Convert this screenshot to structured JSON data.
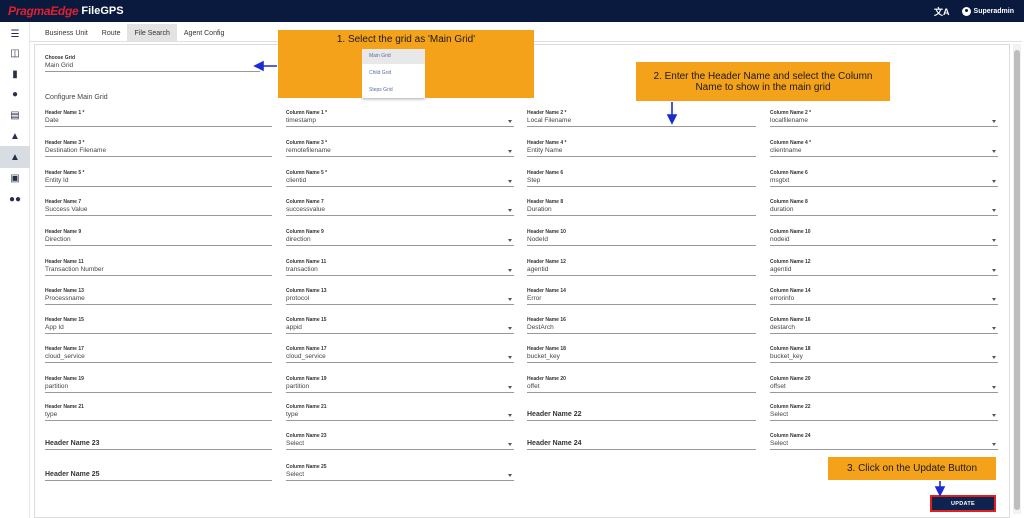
{
  "header": {
    "brand_primary": "PragmaEdge",
    "brand_secondary": "FileGPS",
    "translate_icon": "translate-icon",
    "user_name": "Superadmin",
    "bg_color": "#0a1a3f",
    "brand_color": "#e0202e"
  },
  "sidebar": {
    "items": [
      {
        "icon": "menu-icon"
      },
      {
        "icon": "files-icon"
      },
      {
        "icon": "chart-icon"
      },
      {
        "icon": "account-icon"
      },
      {
        "icon": "document-icon"
      },
      {
        "icon": "bell-icon"
      },
      {
        "icon": "alert-bell-icon"
      },
      {
        "icon": "settings-icon"
      },
      {
        "icon": "group-icon"
      }
    ]
  },
  "tabs": [
    {
      "label": "Business Unit"
    },
    {
      "label": "Route"
    },
    {
      "label": "File Search"
    },
    {
      "label": "Agent Config"
    }
  ],
  "choose_grid": {
    "label": "Choose Grid",
    "value": "Main Grid"
  },
  "grid_dropdown": {
    "options": [
      "Main Grid",
      "Child Grid",
      "Steps Grid"
    ],
    "selected": "Main Grid"
  },
  "config_title": "Configure Main Grid",
  "rows": [
    [
      {
        "label": "Header Name 1 *",
        "value": "Date"
      },
      {
        "label": "Column Name 1 *",
        "value": "timestamp"
      },
      {
        "label": "Header Name 2 *",
        "value": "Local Filename"
      },
      {
        "label": "Column Name 2 *",
        "value": "localfilename"
      }
    ],
    [
      {
        "label": "Header Name 3 *",
        "value": "Destination Filename"
      },
      {
        "label": "Column Name 3 *",
        "value": "remotefilename"
      },
      {
        "label": "Header Name 4 *",
        "value": "Entity Name"
      },
      {
        "label": "Column Name 4 *",
        "value": "clientname"
      }
    ],
    [
      {
        "label": "Header Name 5 *",
        "value": "Entity Id"
      },
      {
        "label": "Column Name 5 *",
        "value": "clientid"
      },
      {
        "label": "Header Name 6",
        "value": "Step"
      },
      {
        "label": "Column Name 6",
        "value": "msgtxt"
      }
    ],
    [
      {
        "label": "Header Name 7",
        "value": "Success Value"
      },
      {
        "label": "Column Name 7",
        "value": "successvalue"
      },
      {
        "label": "Header Name 8",
        "value": "Duration"
      },
      {
        "label": "Column Name 8",
        "value": "duration"
      }
    ],
    [
      {
        "label": "Header Name 9",
        "value": "Direction"
      },
      {
        "label": "Column Name 9",
        "value": "direction"
      },
      {
        "label": "Header Name 10",
        "value": "NodeId"
      },
      {
        "label": "Column Name 10",
        "value": "nodeid"
      }
    ],
    [
      {
        "label": "Header Name 11",
        "value": "Transaction Number"
      },
      {
        "label": "Column Name 11",
        "value": "transaction"
      },
      {
        "label": "Header Name 12",
        "value": "agentid"
      },
      {
        "label": "Column Name 12",
        "value": "agentid"
      }
    ],
    [
      {
        "label": "Header Name 13",
        "value": "Processname"
      },
      {
        "label": "Column Name 13",
        "value": "protocol"
      },
      {
        "label": "Header Name 14",
        "value": "Error"
      },
      {
        "label": "Column Name 14",
        "value": "errorinfo"
      }
    ],
    [
      {
        "label": "Header Name 15",
        "value": "App Id"
      },
      {
        "label": "Column Name 15",
        "value": "appid"
      },
      {
        "label": "Header Name 16",
        "value": "DestArch"
      },
      {
        "label": "Column Name 16",
        "value": "destarch"
      }
    ],
    [
      {
        "label": "Header Name 17",
        "value": "cloud_service"
      },
      {
        "label": "Column Name 17",
        "value": "cloud_service"
      },
      {
        "label": "Header Name 18",
        "value": "bucket_key"
      },
      {
        "label": "Column Name 18",
        "value": "bucket_key"
      }
    ],
    [
      {
        "label": "Header Name 19",
        "value": "partition"
      },
      {
        "label": "Column Name 19",
        "value": "partition"
      },
      {
        "label": "Header Name 20",
        "value": "offet"
      },
      {
        "label": "Column Name 20",
        "value": "offset"
      }
    ]
  ],
  "row21": {
    "h21": {
      "label": "Header Name 21",
      "value": "type"
    },
    "c21": {
      "label": "Column Name 21",
      "value": "type"
    },
    "h22": "Header Name 22",
    "c22": {
      "label": "Column Name 22",
      "value": "Select"
    }
  },
  "row23": {
    "h23": "Header Name 23",
    "c23": {
      "label": "Column Name 23",
      "value": "Select"
    },
    "h24": "Header Name 24",
    "c24": {
      "label": "Column Name 24",
      "value": "Select"
    }
  },
  "row25": {
    "h25": "Header Name 25",
    "c25": {
      "label": "Column Name 25",
      "value": "Select"
    }
  },
  "callouts": {
    "step1": "1. Select the grid as 'Main Grid'",
    "step2": "2. Enter the Header Name and select the Column Name to show in the main grid",
    "step3": "3. Click on the Update Button",
    "color": "#f5a21b"
  },
  "update_button": "UPDATE"
}
